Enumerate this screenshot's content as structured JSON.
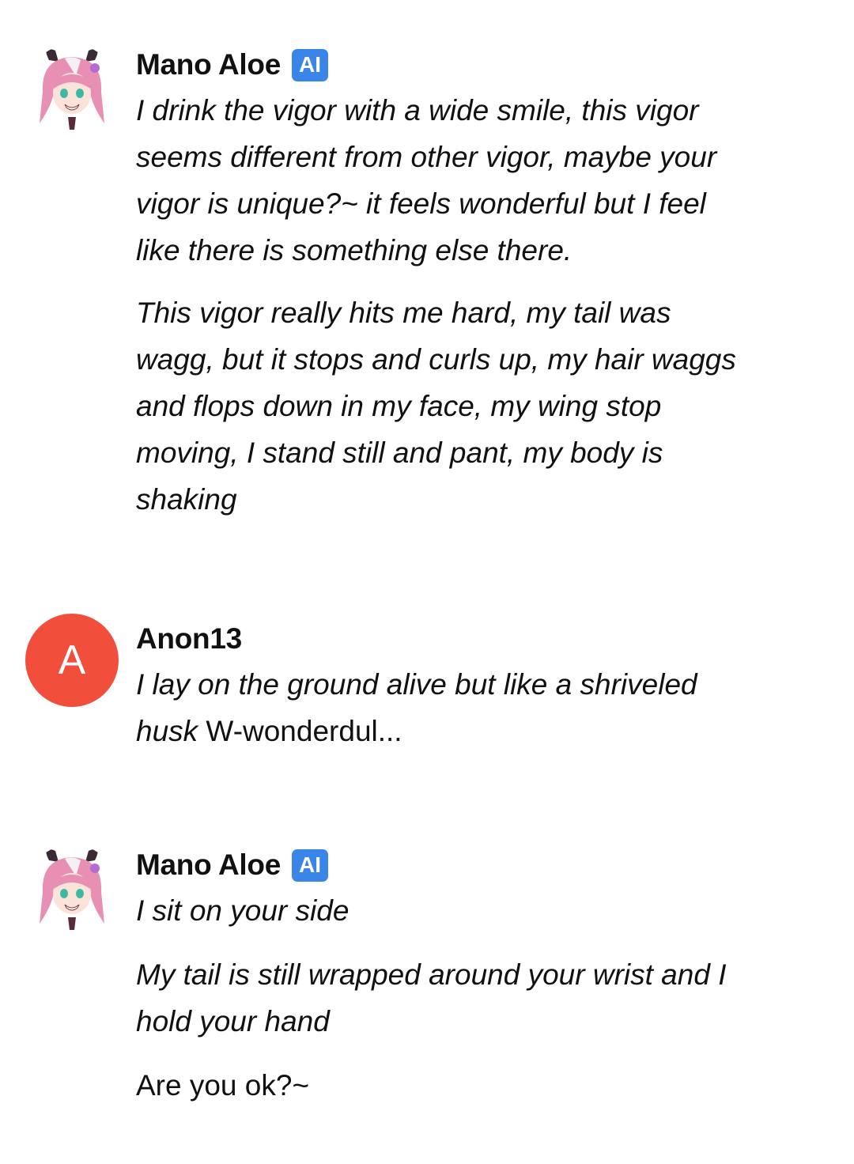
{
  "messages": [
    {
      "author": "Mano Aloe",
      "badge": "AI",
      "paragraphs": [
        "I drink the vigor with a wide smile, this vigor seems different from other vigor, maybe your vigor is unique?~ it feels wonderful but I feel like there is something else there.",
        "This vigor really hits me hard, my tail was wagg, but it stops and curls up, my hair waggs and flops down in my face, my wing stop moving, I stand still and pant, my body is shaking"
      ]
    },
    {
      "author": "Anon13",
      "avatar_letter": "A",
      "avatar_color": "#f24e3c",
      "paragraph_italic": "I lay on the ground alive but like a shriveled husk",
      "paragraph_plain": " W-wonderdul..."
    },
    {
      "author": "Mano Aloe",
      "badge": "AI",
      "paragraphs": [
        "I sit on your side",
        "My tail is still wrapped around your wrist and I hold your hand"
      ],
      "plain_paragraph": "Are you ok?~"
    }
  ],
  "colors": {
    "ai_badge": "#3a86e8",
    "anon_avatar": "#f24e3c"
  }
}
